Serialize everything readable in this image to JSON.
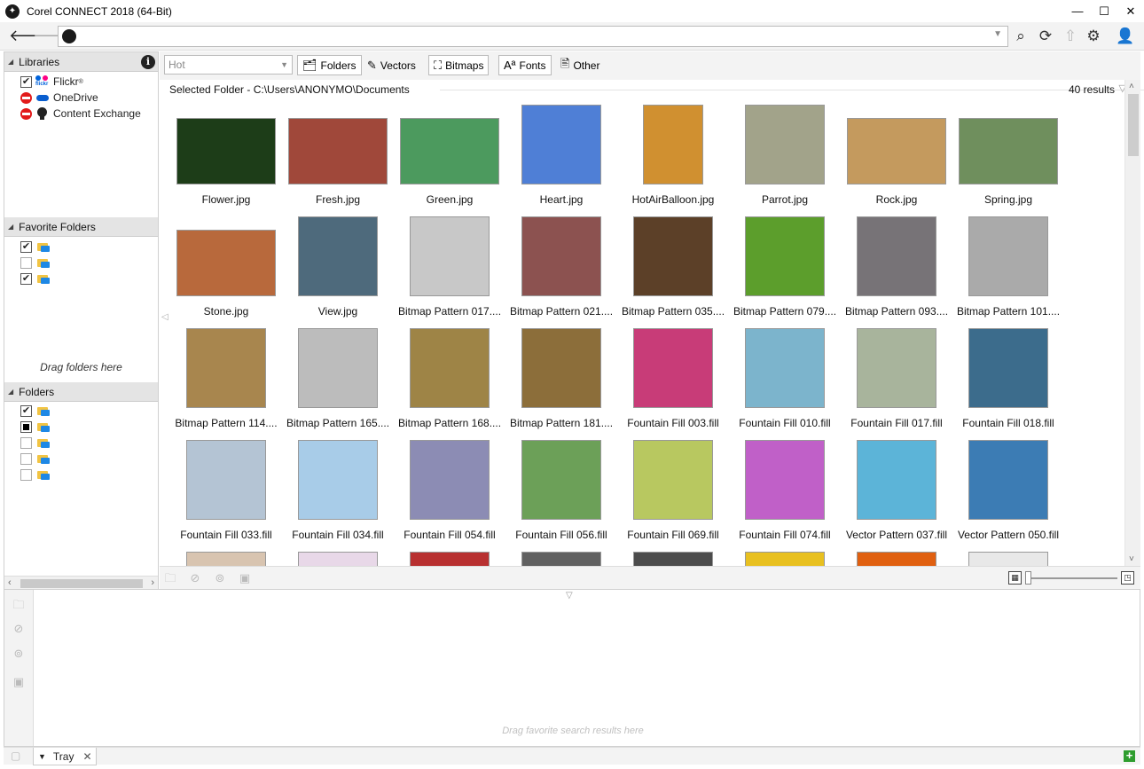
{
  "window": {
    "title": "Corel CONNECT 2018 (64-Bit)",
    "minimize": "—",
    "maximize": "☐",
    "close": "✕"
  },
  "toolbar": {
    "back": "🡐",
    "forward": "🡒",
    "search": "⌕",
    "refresh": "⟳",
    "upload": "⇧",
    "settings": "⚙",
    "account": "👤"
  },
  "libraries": {
    "header": "Libraries",
    "items": [
      {
        "label": "Flickr",
        "sup": "®",
        "checked": true
      },
      {
        "label": "OneDrive",
        "blocked": true
      },
      {
        "label": "Content Exchange",
        "blocked": true
      }
    ]
  },
  "favorites": {
    "header": "Favorite Folders",
    "hint": "Drag folders here"
  },
  "folders": {
    "header": "Folders"
  },
  "filter": {
    "combo": "Hot",
    "buttons": {
      "folders": "Folders",
      "vectors": "Vectors",
      "bitmaps": "Bitmaps",
      "fonts": "Fonts",
      "other": "Other"
    }
  },
  "content": {
    "selected_folder": "Selected Folder - C:\\Users\\ANONYMO\\Documents",
    "results": "40 results",
    "items": [
      {
        "name": "Flower.jpg",
        "color": "#1d3d18"
      },
      {
        "name": "Fresh.jpg",
        "color": "#a0483a"
      },
      {
        "name": "Green.jpg",
        "color": "#4c9a5e"
      },
      {
        "name": "Heart.jpg",
        "color": "#4f7fd6"
      },
      {
        "name": "HotAirBalloon.jpg",
        "color": "#d09030"
      },
      {
        "name": "Parrot.jpg",
        "color": "#a2a38a"
      },
      {
        "name": "Rock.jpg",
        "color": "#c49a5e"
      },
      {
        "name": "Spring.jpg",
        "color": "#6f8f5d"
      },
      {
        "name": "Stone.jpg",
        "color": "#b8693c"
      },
      {
        "name": "View.jpg",
        "color": "#4e6a7c"
      },
      {
        "name": "Bitmap Pattern 017....",
        "color": "#c8c8c8"
      },
      {
        "name": "Bitmap Pattern 021....",
        "color": "#8c5250"
      },
      {
        "name": "Bitmap Pattern 035....",
        "color": "#5c4028"
      },
      {
        "name": "Bitmap Pattern 079....",
        "color": "#5c9e2c"
      },
      {
        "name": "Bitmap Pattern 093....",
        "color": "#777377"
      },
      {
        "name": "Bitmap Pattern 101....",
        "color": "#aaaaaa"
      },
      {
        "name": "Bitmap Pattern 114....",
        "color": "#a8864e"
      },
      {
        "name": "Bitmap Pattern 165....",
        "color": "#bcbcbc"
      },
      {
        "name": "Bitmap Pattern 168....",
        "color": "#9e8446"
      },
      {
        "name": "Bitmap Pattern 181....",
        "color": "#8c6e3a"
      },
      {
        "name": "Fountain Fill 003.fill",
        "color": "#c83c78"
      },
      {
        "name": "Fountain Fill 010.fill",
        "color": "#7cb4cc"
      },
      {
        "name": "Fountain Fill 017.fill",
        "color": "#a8b49c"
      },
      {
        "name": "Fountain Fill 018.fill",
        "color": "#3c6c8c"
      },
      {
        "name": "Fountain Fill 033.fill",
        "color": "#b4c4d4"
      },
      {
        "name": "Fountain Fill 034.fill",
        "color": "#a8cce8"
      },
      {
        "name": "Fountain Fill 054.fill",
        "color": "#8c8cb4"
      },
      {
        "name": "Fountain Fill 056.fill",
        "color": "#6ca058"
      },
      {
        "name": "Fountain Fill 069.fill",
        "color": "#b8c860"
      },
      {
        "name": "Fountain Fill 074.fill",
        "color": "#c060c8"
      },
      {
        "name": "Vector Pattern 037.fill",
        "color": "#5cb4d8"
      },
      {
        "name": "Vector Pattern 050.fill",
        "color": "#3c7cb4"
      },
      {
        "name": "",
        "color": "#d8c4b0"
      },
      {
        "name": "",
        "color": "#e8d8e8"
      },
      {
        "name": "",
        "color": "#b83030"
      },
      {
        "name": "",
        "color": "#606060"
      },
      {
        "name": "",
        "color": "#4c4c4c"
      },
      {
        "name": "",
        "color": "#e8c020"
      },
      {
        "name": "",
        "color": "#e06010"
      },
      {
        "name": "",
        "color": "#e8e8e8"
      }
    ]
  },
  "tray": {
    "hint": "Drag favorite search results here",
    "tab": "Tray"
  }
}
